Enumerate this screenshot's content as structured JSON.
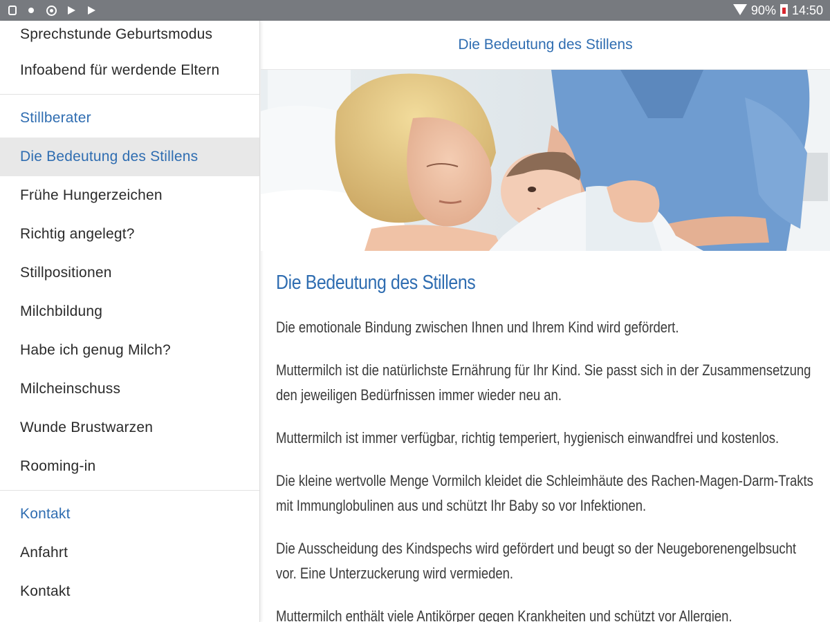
{
  "status_bar": {
    "battery": "90%",
    "time": "14:50",
    "left_icons": [
      "notification-icon",
      "dot-icon",
      "sync-icon",
      "play-icon",
      "play-store-icon"
    ]
  },
  "sidebar": {
    "items": [
      {
        "label": "Sprechstunde Geburtsmodus",
        "type": "item"
      },
      {
        "label": "Infoabend für werdende Eltern",
        "type": "item"
      },
      {
        "label": "Stillberater",
        "type": "section"
      },
      {
        "label": "Die Bedeutung des Stillens",
        "type": "active"
      },
      {
        "label": "Frühe Hungerzeichen",
        "type": "item"
      },
      {
        "label": "Richtig angelegt?",
        "type": "item"
      },
      {
        "label": "Stillpositionen",
        "type": "item"
      },
      {
        "label": "Milchbildung",
        "type": "item"
      },
      {
        "label": "Habe ich genug Milch?",
        "type": "item"
      },
      {
        "label": "Milcheinschuss",
        "type": "item"
      },
      {
        "label": "Wunde Brustwarzen",
        "type": "item"
      },
      {
        "label": "Rooming-in",
        "type": "item"
      },
      {
        "label": "Kontakt",
        "type": "section"
      },
      {
        "label": "Anfahrt",
        "type": "item"
      },
      {
        "label": "Kontakt",
        "type": "item"
      }
    ]
  },
  "header": {
    "title": "Die Bedeutung des Stillens"
  },
  "article": {
    "heading": "Die Bedeutung des Stillens",
    "paragraphs": [
      "Die emotionale Bindung zwischen Ihnen und Ihrem Kind wird gefördert.",
      "Muttermilch ist die natürlichste Ernährung für Ihr Kind. Sie passt sich in der Zusammensetzung den jeweiligen Bedürfnissen immer wieder neu an.",
      "Muttermilch ist immer verfügbar, richtig temperiert, hygienisch einwandfrei und kostenlos.",
      "Die kleine wertvolle Menge Vormilch kleidet die Schleimhäute des Rachen-Magen-Darm-Trakts mit Immunglobulinen aus und schützt Ihr Baby so vor Infektionen.",
      "Die Ausscheidung des Kindspechs wird gefördert und beugt so der Neugeborenengelbsucht vor. Eine Unterzuckerung wird vermieden.",
      "Muttermilch enthält viele Antikörper gegen Krankheiten und schützt vor Allergien."
    ]
  },
  "colors": {
    "accent": "#2f6db1",
    "status_bar": "#777a7f",
    "active_bg": "#e8e8e8"
  }
}
